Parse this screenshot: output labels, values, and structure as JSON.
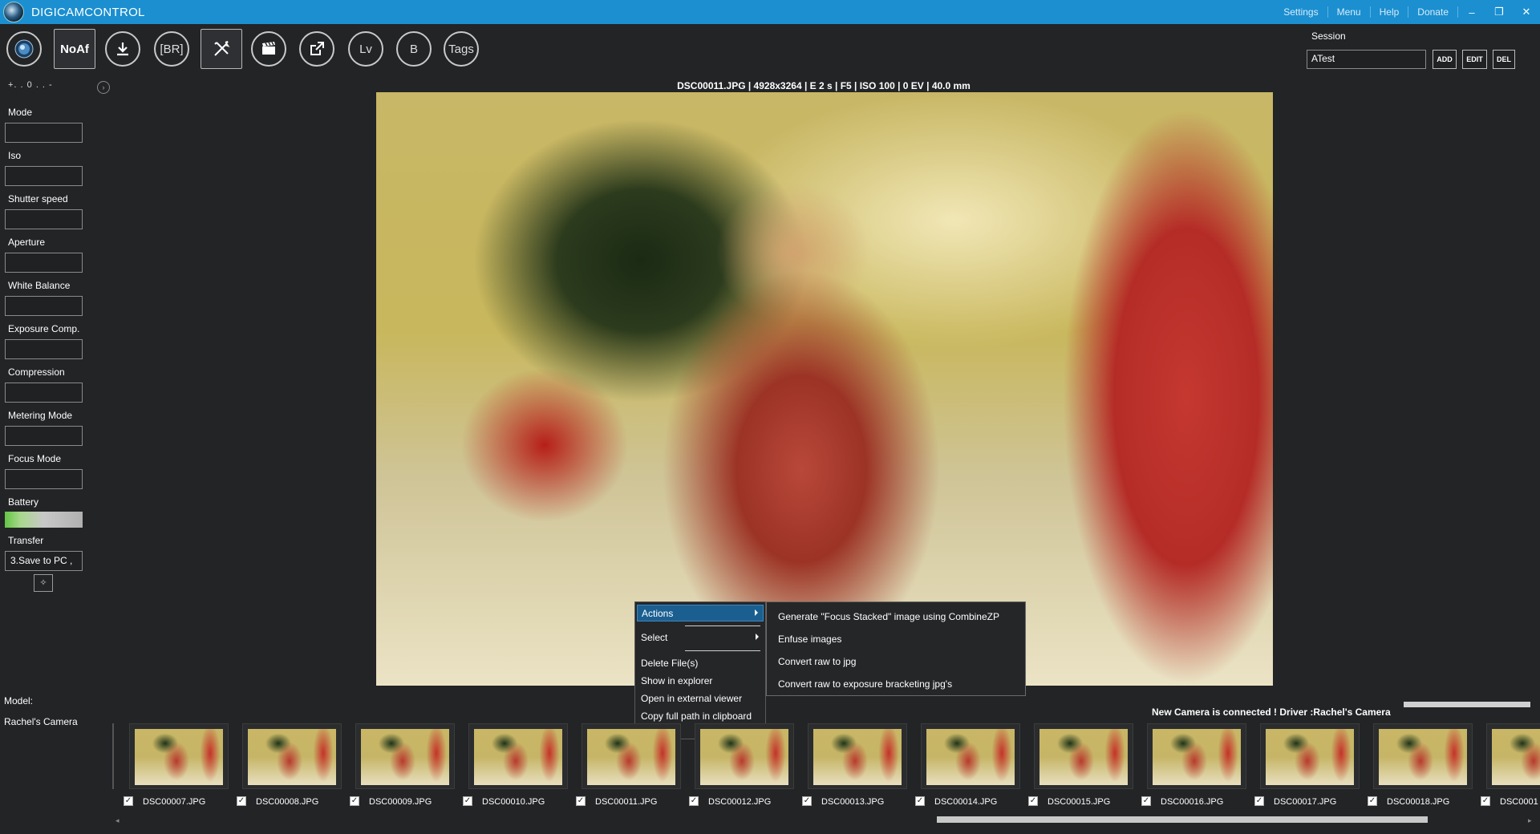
{
  "app": {
    "title": "DIGICAMCONTROL",
    "menu": [
      "Settings",
      "Menu",
      "Help",
      "Donate"
    ],
    "window_controls": [
      "minimize",
      "restore",
      "close"
    ]
  },
  "toolbar": {
    "buttons": [
      {
        "name": "capture",
        "icon": "capture-lens-icon"
      },
      {
        "name": "noaf",
        "label": "NoAf"
      },
      {
        "name": "download",
        "icon": "download-icon"
      },
      {
        "name": "bracketing",
        "label": "[BR]"
      },
      {
        "name": "tools",
        "icon": "tools-icon"
      },
      {
        "name": "movie",
        "icon": "clapperboard-icon"
      },
      {
        "name": "browse",
        "icon": "external-link-icon"
      },
      {
        "name": "liveview",
        "label": "Lv"
      },
      {
        "name": "bulb",
        "label": "B"
      },
      {
        "name": "tags",
        "label": "Tags"
      }
    ]
  },
  "session": {
    "label": "Session",
    "value": "ATest",
    "add": "ADD",
    "edit": "EDIT",
    "del": "DEL"
  },
  "left_panel": {
    "ev_scale": "+. . 0 . . -",
    "properties": [
      {
        "label": "Mode",
        "value": ""
      },
      {
        "label": "Iso",
        "value": ""
      },
      {
        "label": "Shutter speed",
        "value": ""
      },
      {
        "label": "Aperture",
        "value": ""
      },
      {
        "label": "White Balance",
        "value": ""
      },
      {
        "label": "Exposure Comp.",
        "value": ""
      },
      {
        "label": "Compression",
        "value": ""
      },
      {
        "label": "Metering Mode",
        "value": ""
      },
      {
        "label": "Focus Mode",
        "value": ""
      }
    ],
    "battery_label": "Battery",
    "transfer_label": "Transfer",
    "transfer_value": "3.Save to PC ,",
    "model_label": "Model:",
    "model_value": "Rachel's Camera"
  },
  "image": {
    "info": "DSC00011.JPG | 4928x3264 | E 2 s | F5 | ISO 100 | 0 EV | 40.0 mm"
  },
  "context_menu": {
    "items": [
      "Actions",
      "Select",
      "Delete File(s)",
      "Show in explorer",
      "Open in external viewer",
      "Copy full path in clipboard"
    ],
    "submenu": [
      "Generate \"Focus Stacked\" image using CombineZP",
      "Enfuse images",
      "Convert raw to jpg",
      "Convert raw to exposure bracketing jpg's"
    ]
  },
  "status": {
    "message": "New Camera is connected ! Driver :Rachel's Camera"
  },
  "thumbnails": [
    {
      "file": "DSC00007.JPG",
      "checked": true
    },
    {
      "file": "DSC00008.JPG",
      "checked": true
    },
    {
      "file": "DSC00009.JPG",
      "checked": true
    },
    {
      "file": "DSC00010.JPG",
      "checked": true
    },
    {
      "file": "DSC00011.JPG",
      "checked": true
    },
    {
      "file": "DSC00012.JPG",
      "checked": true
    },
    {
      "file": "DSC00013.JPG",
      "checked": true
    },
    {
      "file": "DSC00014.JPG",
      "checked": true
    },
    {
      "file": "DSC00015.JPG",
      "checked": true
    },
    {
      "file": "DSC00016.JPG",
      "checked": true
    },
    {
      "file": "DSC00017.JPG",
      "checked": true
    },
    {
      "file": "DSC00018.JPG",
      "checked": true
    },
    {
      "file": "DSC0001",
      "checked": true
    }
  ]
}
